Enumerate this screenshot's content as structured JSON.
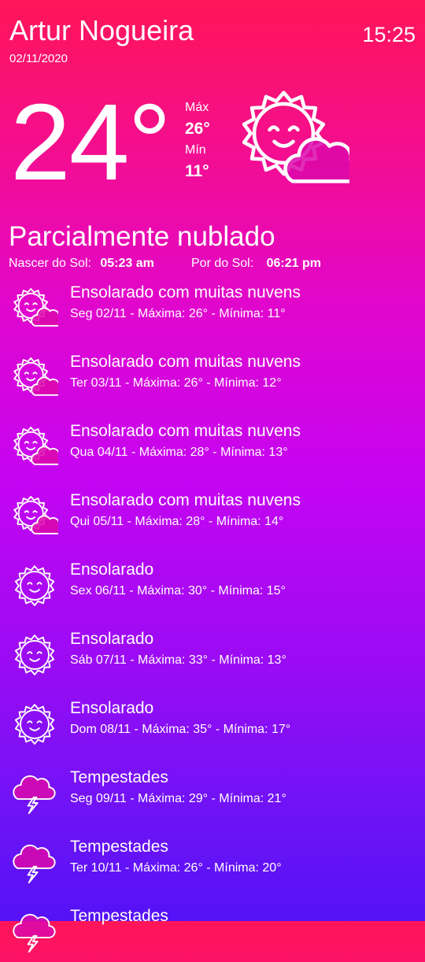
{
  "header": {
    "city": "Artur Nogueira",
    "date": "02/11/2020",
    "time": "15:25"
  },
  "current": {
    "temp": "24°",
    "max_label": "Máx",
    "max_value": "26°",
    "min_label": "Mín",
    "min_value": "11°",
    "icon": "sun-cloud-icon",
    "condition": "Parcialmente nublado",
    "sunrise_label": "Nascer do Sol:",
    "sunrise_value": "05:23 am",
    "sunset_label": "Por do Sol:",
    "sunset_value": "06:21 pm"
  },
  "forecast": [
    {
      "title": "Ensolarado com muitas nuvens",
      "detail": "Seg 02/11 - Máxima: 26° - Mínima: 11°",
      "icon": "sun-cloud-icon"
    },
    {
      "title": "Ensolarado com muitas nuvens",
      "detail": "Ter 03/11 - Máxima: 26° - Mínima: 12°",
      "icon": "sun-cloud-icon"
    },
    {
      "title": "Ensolarado com muitas nuvens",
      "detail": "Qua 04/11 - Máxima: 28° - Mínima: 13°",
      "icon": "sun-cloud-icon"
    },
    {
      "title": "Ensolarado com muitas nuvens",
      "detail": "Qui 05/11 - Máxima: 28° - Mínima: 14°",
      "icon": "sun-cloud-icon"
    },
    {
      "title": "Ensolarado",
      "detail": "Sex 06/11 - Máxima: 30° - Mínima: 15°",
      "icon": "sun-icon"
    },
    {
      "title": "Ensolarado",
      "detail": "Sáb 07/11 - Máxima: 33° - Mínima: 13°",
      "icon": "sun-icon"
    },
    {
      "title": "Ensolarado",
      "detail": "Dom 08/11 - Máxima: 35° - Mínima: 17°",
      "icon": "sun-icon"
    },
    {
      "title": "Tempestades",
      "detail": "Seg 09/11 - Máxima: 29° - Mínima: 21°",
      "icon": "storm-icon"
    },
    {
      "title": "Tempestades",
      "detail": "Ter 10/11 - Máxima: 26° - Mínima: 20°",
      "icon": "storm-icon"
    },
    {
      "title": "Tempestades",
      "detail": "",
      "icon": "storm-icon"
    }
  ]
}
